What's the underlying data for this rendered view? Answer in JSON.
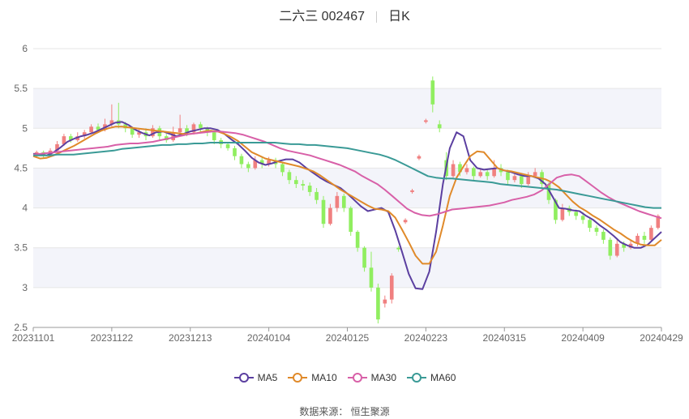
{
  "header": {
    "stock_name": "二六三 002467",
    "period": "日K"
  },
  "footer": {
    "source": "数据来源：  恒生聚源"
  },
  "chart_data": {
    "type": "candlestick",
    "title": "二六三 002467",
    "ylim": [
      2.5,
      6
    ],
    "yticks": [
      2.5,
      3,
      3.5,
      4,
      4.5,
      5,
      5.5,
      6
    ],
    "x_tick_labels": [
      "20231101",
      "20231122",
      "20231213",
      "20240104",
      "20240125",
      "20240223",
      "20240315",
      "20240409",
      "20240429"
    ],
    "up_color": "#f08080",
    "down_color": "#90ee60",
    "series": [
      {
        "name": "MA5",
        "color": "#5b3fa0",
        "values": [
          4.68,
          4.67,
          4.66,
          4.7,
          4.76,
          4.83,
          4.87,
          4.9,
          4.92,
          4.95,
          4.99,
          5.03,
          5.07,
          5.08,
          5.04,
          4.98,
          4.94,
          4.91,
          4.95,
          4.96,
          4.93,
          4.9,
          4.93,
          4.96,
          4.98,
          5.0,
          5.0,
          4.98,
          4.93,
          4.86,
          4.8,
          4.72,
          4.63,
          4.57,
          4.54,
          4.56,
          4.59,
          4.61,
          4.61,
          4.57,
          4.5,
          4.44,
          4.38,
          4.33,
          4.29,
          4.25,
          4.18,
          4.1,
          4.02,
          3.96,
          3.98,
          4.0,
          3.95,
          3.72,
          3.45,
          3.17,
          2.99,
          2.98,
          3.2,
          3.7,
          4.3,
          4.75,
          4.95,
          4.9,
          4.6,
          4.5,
          4.48,
          4.49,
          4.5,
          4.47,
          4.45,
          4.42,
          4.4,
          4.4,
          4.37,
          4.3,
          4.15,
          4.0,
          3.99,
          3.97,
          3.96,
          3.9,
          3.85,
          3.78,
          3.72,
          3.65,
          3.57,
          3.53,
          3.5,
          3.5,
          3.54,
          3.62,
          3.7
        ]
      },
      {
        "name": "MA10",
        "color": "#e08a2a",
        "values": [
          4.65,
          4.62,
          4.63,
          4.66,
          4.7,
          4.74,
          4.78,
          4.83,
          4.88,
          4.93,
          4.97,
          5.0,
          5.02,
          5.02,
          5.01,
          5.0,
          4.99,
          4.98,
          4.97,
          4.96,
          4.95,
          4.94,
          4.93,
          4.93,
          4.94,
          4.96,
          4.97,
          4.96,
          4.93,
          4.89,
          4.84,
          4.77,
          4.7,
          4.66,
          4.62,
          4.6,
          4.58,
          4.56,
          4.54,
          4.52,
          4.49,
          4.46,
          4.41,
          4.35,
          4.29,
          4.23,
          4.18,
          4.13,
          4.08,
          4.03,
          3.99,
          3.98,
          3.96,
          3.88,
          3.73,
          3.57,
          3.4,
          3.3,
          3.3,
          3.45,
          3.78,
          4.15,
          4.38,
          4.52,
          4.65,
          4.71,
          4.7,
          4.6,
          4.5,
          4.47,
          4.46,
          4.44,
          4.42,
          4.4,
          4.38,
          4.36,
          4.32,
          4.26,
          4.17,
          4.08,
          4.01,
          3.96,
          3.9,
          3.85,
          3.79,
          3.73,
          3.68,
          3.62,
          3.57,
          3.54,
          3.53,
          3.53,
          3.6
        ]
      },
      {
        "name": "MA30",
        "color": "#d860a8",
        "values": [
          4.67,
          4.68,
          4.69,
          4.7,
          4.71,
          4.72,
          4.73,
          4.74,
          4.75,
          4.76,
          4.77,
          4.79,
          4.8,
          4.81,
          4.81,
          4.82,
          4.83,
          4.85,
          4.87,
          4.89,
          4.91,
          4.93,
          4.94,
          4.95,
          4.96,
          4.96,
          4.95,
          4.94,
          4.92,
          4.89,
          4.86,
          4.83,
          4.79,
          4.75,
          4.72,
          4.7,
          4.68,
          4.66,
          4.63,
          4.6,
          4.57,
          4.54,
          4.5,
          4.46,
          4.4,
          4.35,
          4.3,
          4.23,
          4.15,
          4.07,
          3.99,
          3.94,
          3.91,
          3.9,
          3.92,
          3.95,
          3.98,
          3.99,
          4.0,
          4.01,
          4.02,
          4.03,
          4.05,
          4.07,
          4.1,
          4.12,
          4.14,
          4.17,
          4.22,
          4.3,
          4.38,
          4.41,
          4.42,
          4.4,
          4.33,
          4.26,
          4.19,
          4.13,
          4.08,
          4.04,
          4.0,
          3.96,
          3.93,
          3.9,
          3.87
        ]
      },
      {
        "name": "MA60",
        "color": "#3a9a96",
        "values": [
          4.66,
          4.66,
          4.66,
          4.67,
          4.67,
          4.67,
          4.68,
          4.69,
          4.7,
          4.71,
          4.72,
          4.74,
          4.75,
          4.76,
          4.77,
          4.78,
          4.79,
          4.79,
          4.8,
          4.8,
          4.81,
          4.81,
          4.82,
          4.82,
          4.82,
          4.82,
          4.82,
          4.82,
          4.82,
          4.82,
          4.82,
          4.81,
          4.8,
          4.8,
          4.79,
          4.79,
          4.78,
          4.77,
          4.76,
          4.75,
          4.73,
          4.71,
          4.69,
          4.67,
          4.64,
          4.6,
          4.55,
          4.5,
          4.45,
          4.4,
          4.38,
          4.37,
          4.37,
          4.36,
          4.35,
          4.34,
          4.33,
          4.32,
          4.3,
          4.29,
          4.28,
          4.27,
          4.26,
          4.25,
          4.24,
          4.23,
          4.21,
          4.19,
          4.17,
          4.15,
          4.13,
          4.11,
          4.09,
          4.07,
          4.05,
          4.03,
          4.01,
          4.0,
          4.0
        ]
      }
    ],
    "candles": [
      [
        4.66,
        4.7,
        4.72,
        4.63
      ],
      [
        4.7,
        4.65,
        4.72,
        4.63
      ],
      [
        4.65,
        4.72,
        4.75,
        4.64
      ],
      [
        4.72,
        4.8,
        4.84,
        4.7
      ],
      [
        4.8,
        4.9,
        4.93,
        4.78
      ],
      [
        4.9,
        4.85,
        4.93,
        4.82
      ],
      [
        4.85,
        4.9,
        4.95,
        4.83
      ],
      [
        4.9,
        4.95,
        4.98,
        4.87
      ],
      [
        4.95,
        5.02,
        5.05,
        4.93
      ],
      [
        5.02,
        4.98,
        5.06,
        4.95
      ],
      [
        4.98,
        5.05,
        5.12,
        4.96
      ],
      [
        5.05,
        5.1,
        5.3,
        5.02
      ],
      [
        5.1,
        5.05,
        5.32,
        5.0
      ],
      [
        5.05,
        5.0,
        5.08,
        4.95
      ],
      [
        5.0,
        4.92,
        5.02,
        4.88
      ],
      [
        4.92,
        4.95,
        5.0,
        4.88
      ],
      [
        4.95,
        4.9,
        5.0,
        4.85
      ],
      [
        4.9,
        5.0,
        5.04,
        4.88
      ],
      [
        5.0,
        4.9,
        5.03,
        4.85
      ],
      [
        4.9,
        4.85,
        4.93,
        4.82
      ],
      [
        4.85,
        4.95,
        5.02,
        4.83
      ],
      [
        4.95,
        5.0,
        5.17,
        4.92
      ],
      [
        5.0,
        4.95,
        5.04,
        4.9
      ],
      [
        4.95,
        5.05,
        5.07,
        4.93
      ],
      [
        5.05,
        5.0,
        5.08,
        4.95
      ],
      [
        5.0,
        4.95,
        5.02,
        4.9
      ],
      [
        4.95,
        4.85,
        4.97,
        4.8
      ],
      [
        4.85,
        4.8,
        4.88,
        4.75
      ],
      [
        4.8,
        4.75,
        4.83,
        4.72
      ],
      [
        4.75,
        4.65,
        4.78,
        4.6
      ],
      [
        4.65,
        4.55,
        4.68,
        4.5
      ],
      [
        4.55,
        4.5,
        4.58,
        4.45
      ],
      [
        4.5,
        4.6,
        4.65,
        4.48
      ],
      [
        4.6,
        4.55,
        4.63,
        4.5
      ],
      [
        4.55,
        4.6,
        4.64,
        4.52
      ],
      [
        4.6,
        4.55,
        4.63,
        4.5
      ],
      [
        4.55,
        4.45,
        4.58,
        4.4
      ],
      [
        4.45,
        4.35,
        4.48,
        4.3
      ],
      [
        4.35,
        4.3,
        4.4,
        4.25
      ],
      [
        4.3,
        4.28,
        4.35,
        4.22
      ],
      [
        4.28,
        4.2,
        4.32,
        4.15
      ],
      [
        4.2,
        4.1,
        4.25,
        4.05
      ],
      [
        4.1,
        3.8,
        4.15,
        3.75
      ],
      [
        3.8,
        4.0,
        4.05,
        3.78
      ],
      [
        4.0,
        4.15,
        4.2,
        3.95
      ],
      [
        4.15,
        4.0,
        4.18,
        3.95
      ],
      [
        4.0,
        3.7,
        4.02,
        3.65
      ],
      [
        3.7,
        3.5,
        3.72,
        3.45
      ],
      [
        3.5,
        3.25,
        3.52,
        3.2
      ],
      [
        3.25,
        3.0,
        3.45,
        2.95
      ],
      [
        3.0,
        2.6,
        3.05,
        2.55
      ],
      [
        2.8,
        2.85,
        2.9,
        2.75
      ],
      [
        2.85,
        3.15,
        3.18,
        2.8
      ],
      [
        3.5,
        3.48,
        3.52,
        3.45
      ],
      [
        3.82,
        3.85,
        3.87,
        3.8
      ],
      [
        4.2,
        4.22,
        4.24,
        4.18
      ],
      [
        4.62,
        4.65,
        4.67,
        4.6
      ],
      [
        5.08,
        5.1,
        5.12,
        5.06
      ],
      [
        5.6,
        5.3,
        5.65,
        5.2
      ],
      [
        5.05,
        5.0,
        5.1,
        4.95
      ],
      [
        4.6,
        4.4,
        4.7,
        4.35
      ],
      [
        4.4,
        4.55,
        4.6,
        4.38
      ],
      [
        4.55,
        4.45,
        4.58,
        4.4
      ],
      [
        4.45,
        4.5,
        4.55,
        4.42
      ],
      [
        4.5,
        4.4,
        4.52,
        4.35
      ],
      [
        4.4,
        4.45,
        4.5,
        4.38
      ],
      [
        4.45,
        4.4,
        4.48,
        4.35
      ],
      [
        4.4,
        4.5,
        4.6,
        4.38
      ],
      [
        4.5,
        4.45,
        4.55,
        4.4
      ],
      [
        4.45,
        4.35,
        4.48,
        4.3
      ],
      [
        4.35,
        4.4,
        4.45,
        4.32
      ],
      [
        4.4,
        4.3,
        4.43,
        4.25
      ],
      [
        4.3,
        4.4,
        4.45,
        4.28
      ],
      [
        4.4,
        4.45,
        4.5,
        4.38
      ],
      [
        4.45,
        4.3,
        4.48,
        4.25
      ],
      [
        4.3,
        4.1,
        4.32,
        4.05
      ],
      [
        4.1,
        3.85,
        4.12,
        3.8
      ],
      [
        3.85,
        4.0,
        4.05,
        3.83
      ],
      [
        4.0,
        3.95,
        4.03,
        3.9
      ],
      [
        3.95,
        3.9,
        3.98,
        3.85
      ],
      [
        3.9,
        3.85,
        3.95,
        3.8
      ],
      [
        3.85,
        3.75,
        3.88,
        3.7
      ],
      [
        3.75,
        3.7,
        3.78,
        3.65
      ],
      [
        3.7,
        3.6,
        3.73,
        3.55
      ],
      [
        3.6,
        3.4,
        3.63,
        3.35
      ],
      [
        3.4,
        3.55,
        3.6,
        3.38
      ],
      [
        3.55,
        3.5,
        3.58,
        3.45
      ],
      [
        3.5,
        3.55,
        3.6,
        3.48
      ],
      [
        3.55,
        3.65,
        3.68,
        3.52
      ],
      [
        3.65,
        3.6,
        3.7,
        3.55
      ],
      [
        3.6,
        3.75,
        3.78,
        3.58
      ],
      [
        3.75,
        3.9,
        3.92,
        3.73
      ]
    ]
  }
}
